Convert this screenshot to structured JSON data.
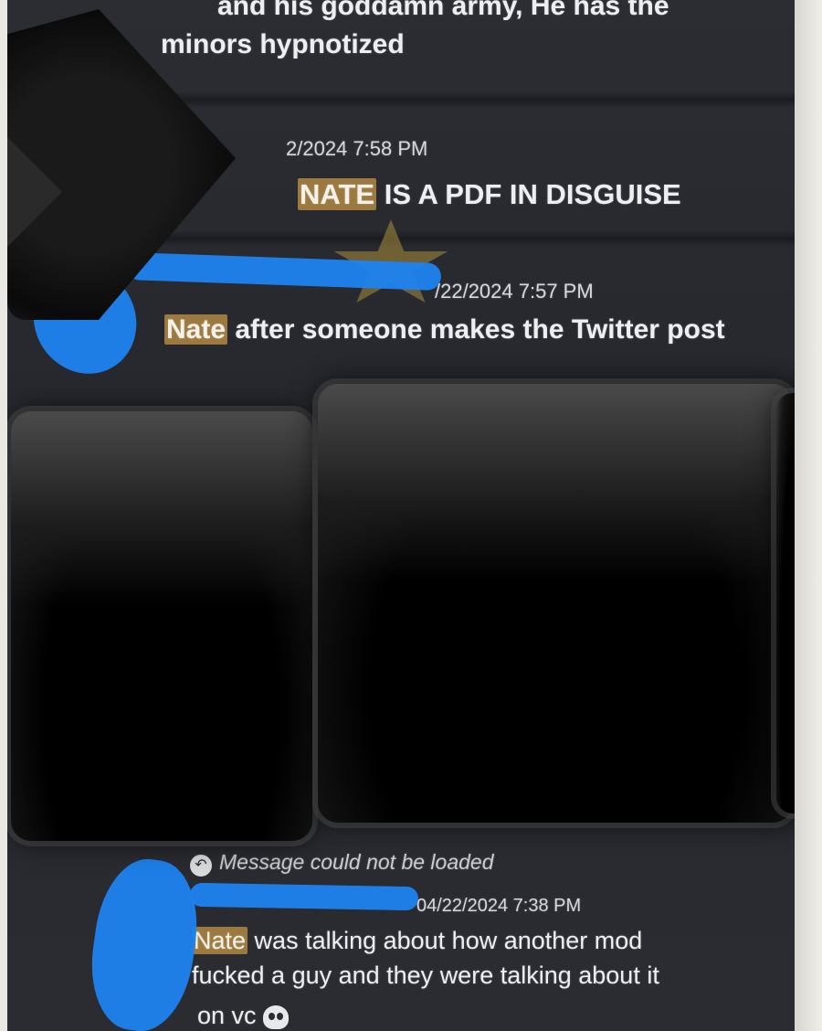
{
  "messages": [
    {
      "line1": "and his goddamn army, He has the",
      "line2": "minors hypnotized"
    },
    {
      "timestamp": "2/2024 7:58 PM",
      "highlight": "NATE",
      "text": " IS A PDF IN DISGUISE"
    },
    {
      "timestamp": "/22/2024 7:57 PM",
      "highlight": "Nate",
      "text": " after someone makes the Twitter post"
    },
    {
      "reply_text": "Message could not be loaded",
      "timestamp": "04/22/2024 7:38 PM",
      "highlight": "Nate",
      "line1": " was talking about how another mod",
      "line2": "fucked a guy and they were talking about it",
      "line3": "on vc"
    }
  ],
  "icons": {
    "reply": "reply-arrow-icon",
    "skull": "skull-emoji-icon"
  },
  "colors": {
    "background": "#2b2d33",
    "text": "#eceef1",
    "mention_highlight": "#9c7a3f",
    "redaction_scribble": "#1e83f0"
  }
}
